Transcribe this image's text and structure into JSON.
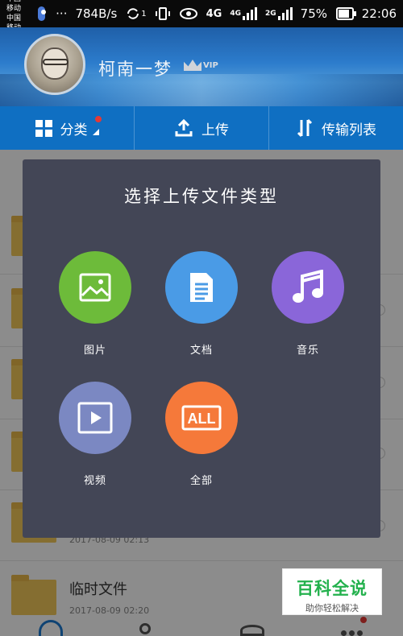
{
  "status_bar": {
    "carrier_1": "中国移动",
    "carrier_2": "中国移动",
    "overflow": "···",
    "speed": "784B/s",
    "sim_badge": "1",
    "net_1": "4G",
    "net_2": "4G",
    "net_3": "2G",
    "battery_percent": "75%",
    "battery_level": 0.75,
    "time": "22:06"
  },
  "header": {
    "username": "柯南一梦",
    "vip_label": "VIP"
  },
  "toolbar": {
    "category": "分类",
    "upload": "上传",
    "transfer": "传输列表"
  },
  "background_list": {
    "last_folder_title": "临时文件",
    "last_folder_date": "2017-08-09  02:20",
    "prev_folder_date": "2017-08-09  02:13"
  },
  "dialog": {
    "title": "选择上传文件类型",
    "options": [
      {
        "label": "图片",
        "icon": "image-icon",
        "color": "#6dbb3a"
      },
      {
        "label": "文档",
        "icon": "document-icon",
        "color": "#4a9be6"
      },
      {
        "label": "音乐",
        "icon": "music-icon",
        "color": "#8a66d9"
      },
      {
        "label": "视频",
        "icon": "video-icon",
        "color": "#7b88c2"
      },
      {
        "label": "全部",
        "icon": "all-icon",
        "color": "#f5793a"
      }
    ]
  },
  "watermark": {
    "main": "百科全说",
    "sub": "助你轻松解决"
  },
  "colors": {
    "toolbar_bg": "#0f6fc2",
    "dialog_bg": "#434656",
    "watermark_green": "#23b14d"
  }
}
